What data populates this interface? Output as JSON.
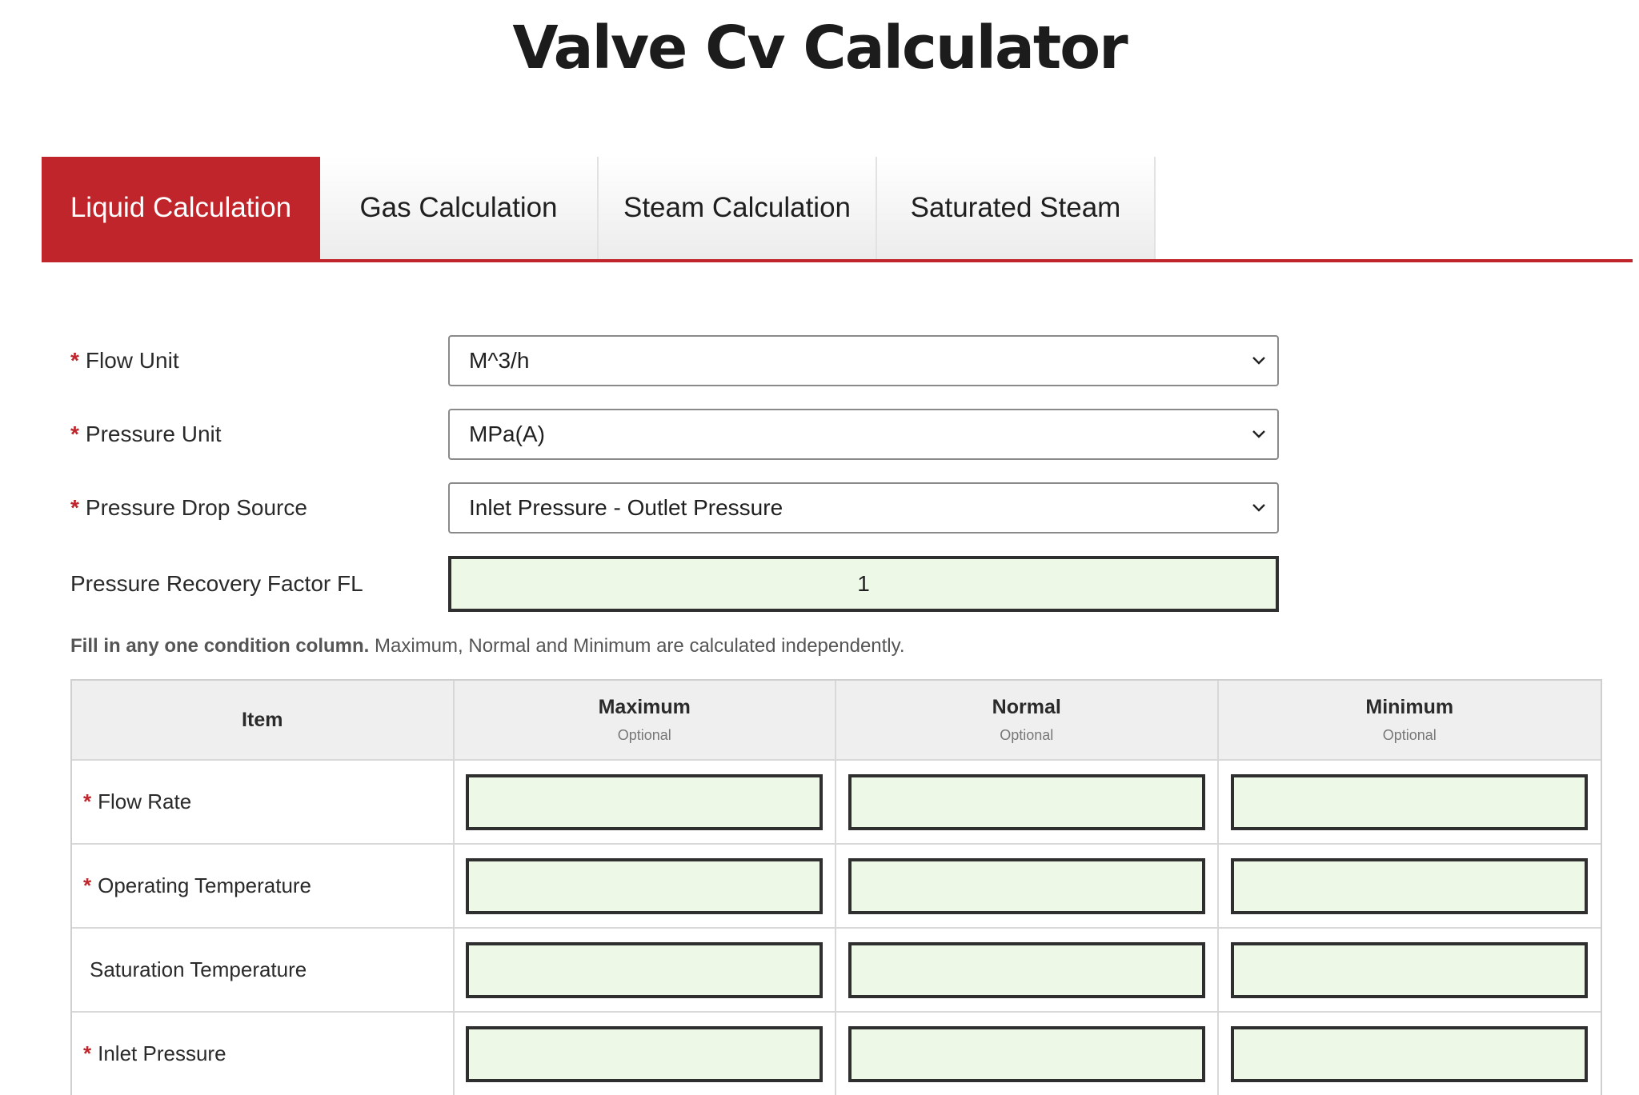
{
  "page_title": "Valve Cv Calculator",
  "tabs": [
    {
      "label": "Liquid Calculation",
      "active": true
    },
    {
      "label": "Gas Calculation",
      "active": false
    },
    {
      "label": "Steam Calculation",
      "active": false
    },
    {
      "label": "Saturated Steam",
      "active": false
    }
  ],
  "form": {
    "flow_unit": {
      "required_mark": "*",
      "label": "Flow Unit",
      "value": "M^3/h"
    },
    "pressure_unit": {
      "required_mark": "*",
      "label": "Pressure Unit",
      "value": "MPa(A)"
    },
    "pressure_drop_source": {
      "required_mark": "*",
      "label": "Pressure Drop Source",
      "value": "Inlet Pressure - Outlet Pressure"
    },
    "recovery_factor": {
      "label": "Pressure Recovery Factor FL",
      "value": "1"
    }
  },
  "note": {
    "bold": "Fill in any one condition column.",
    "text": "Maximum, Normal and Minimum are calculated independently."
  },
  "table": {
    "headers": [
      {
        "title": "Item",
        "sub": ""
      },
      {
        "title": "Maximum",
        "sub": "Optional"
      },
      {
        "title": "Normal",
        "sub": "Optional"
      },
      {
        "title": "Minimum",
        "sub": "Optional"
      }
    ],
    "rows": [
      {
        "required_mark": "*",
        "label": "Flow Rate",
        "values": [
          "",
          "",
          ""
        ]
      },
      {
        "required_mark": "*",
        "label": "Operating Temperature",
        "values": [
          "",
          "",
          ""
        ]
      },
      {
        "required_mark": "",
        "label": "Saturation Temperature",
        "values": [
          "",
          "",
          ""
        ]
      },
      {
        "required_mark": "*",
        "label": "Inlet Pressure",
        "values": [
          "",
          "",
          ""
        ]
      }
    ]
  },
  "colors": {
    "accent": "#c0252b",
    "input_fill": "#eef8e6"
  }
}
